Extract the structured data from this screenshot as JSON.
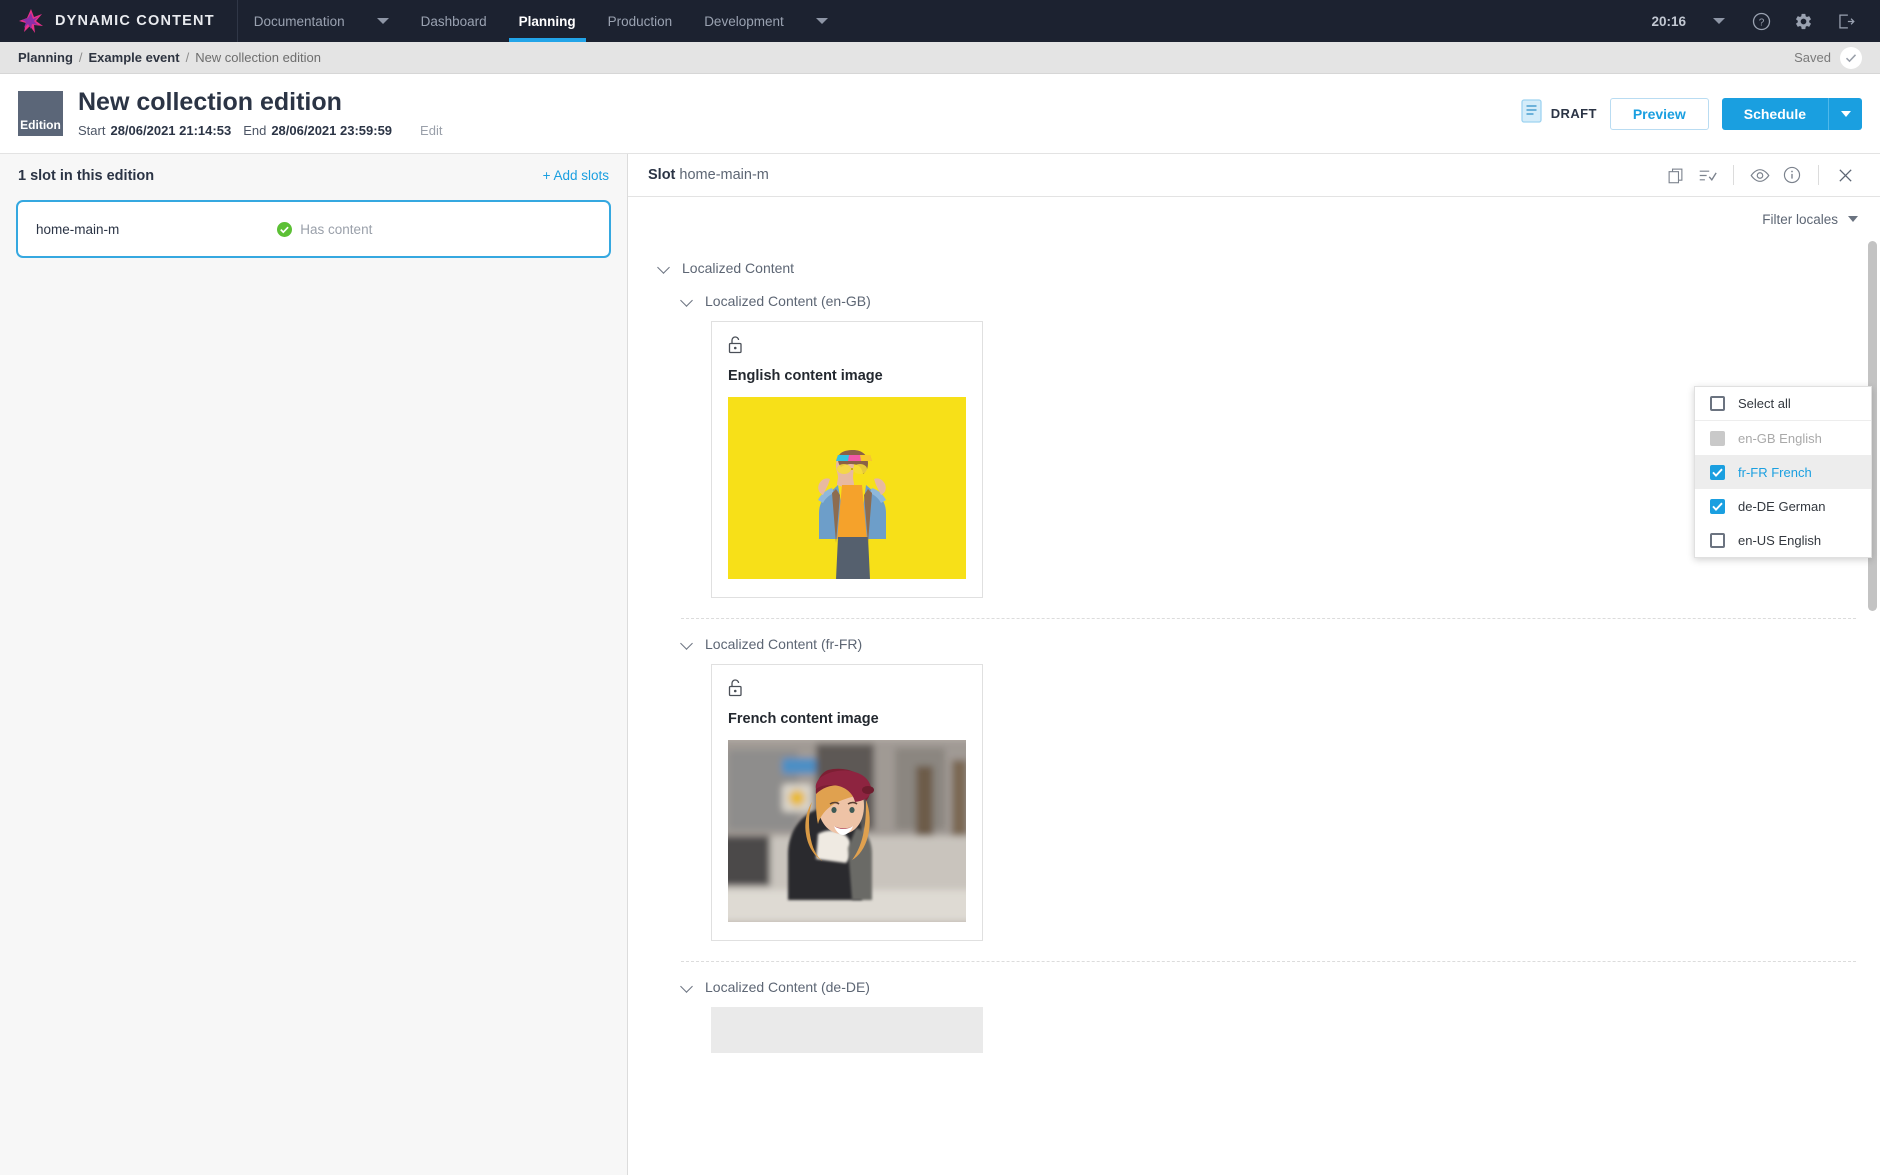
{
  "topnav": {
    "brand": "DYNAMIC CONTENT",
    "tabs": [
      {
        "label": "Documentation",
        "active": false
      },
      {
        "label": "Dashboard",
        "active": false
      },
      {
        "label": "Planning",
        "active": true
      },
      {
        "label": "Production",
        "active": false
      },
      {
        "label": "Development",
        "active": false
      }
    ],
    "clock": "20:16",
    "icons": [
      "help-icon",
      "gear-icon",
      "logout-icon"
    ]
  },
  "breadcrumb": {
    "items": [
      "Planning",
      "Example event",
      "New collection edition"
    ],
    "separator": "/",
    "status": "Saved"
  },
  "edition": {
    "badge": "Edition",
    "title": "New collection edition",
    "start_label": "Start",
    "start_value": "28/06/2021 21:14:53",
    "end_label": "End",
    "end_value": "28/06/2021 23:59:59",
    "edit_label": "Edit",
    "state": "DRAFT",
    "preview_label": "Preview",
    "schedule_label": "Schedule"
  },
  "slots_panel": {
    "heading": "1 slot in this edition",
    "add_label": "+ Add slots",
    "slot": {
      "name": "home-main-m",
      "status": "Has content"
    }
  },
  "slot_detail": {
    "title_label": "Slot",
    "title_value": "home-main-m",
    "icons": [
      "duplicate-icon",
      "list-check-icon",
      "visibility-icon",
      "info-icon",
      "close-icon"
    ],
    "filter_label": "Filter locales"
  },
  "locale_menu": {
    "items": [
      {
        "label": "Select all",
        "state": "unchecked",
        "disabled": false,
        "hovered": false
      },
      {
        "label": "en-GB English",
        "state": "filled",
        "disabled": true,
        "hovered": false
      },
      {
        "label": "fr-FR French",
        "state": "checked",
        "disabled": false,
        "hovered": true
      },
      {
        "label": "de-DE German",
        "state": "checked",
        "disabled": false,
        "hovered": false
      },
      {
        "label": "en-US English",
        "state": "unchecked",
        "disabled": false,
        "hovered": false
      }
    ]
  },
  "content": {
    "root_label": "Localized Content",
    "sections": [
      {
        "heading": "Localized Content (en-GB)",
        "card_title": "English content image",
        "image": "yellow-background-woman-denim-jacket",
        "has_image": true
      },
      {
        "heading": "Localized Content (fr-FR)",
        "card_title": "French content image",
        "image": "street-woman-burgundy-beret",
        "has_image": true
      },
      {
        "heading": "Localized Content (de-DE)",
        "card_title": "",
        "image": "",
        "has_image": false
      }
    ]
  },
  "colors": {
    "nav_bg": "#1c2230",
    "accent": "#1a9fe0",
    "brand_pink": "#e8308a",
    "success": "#5cc035"
  }
}
